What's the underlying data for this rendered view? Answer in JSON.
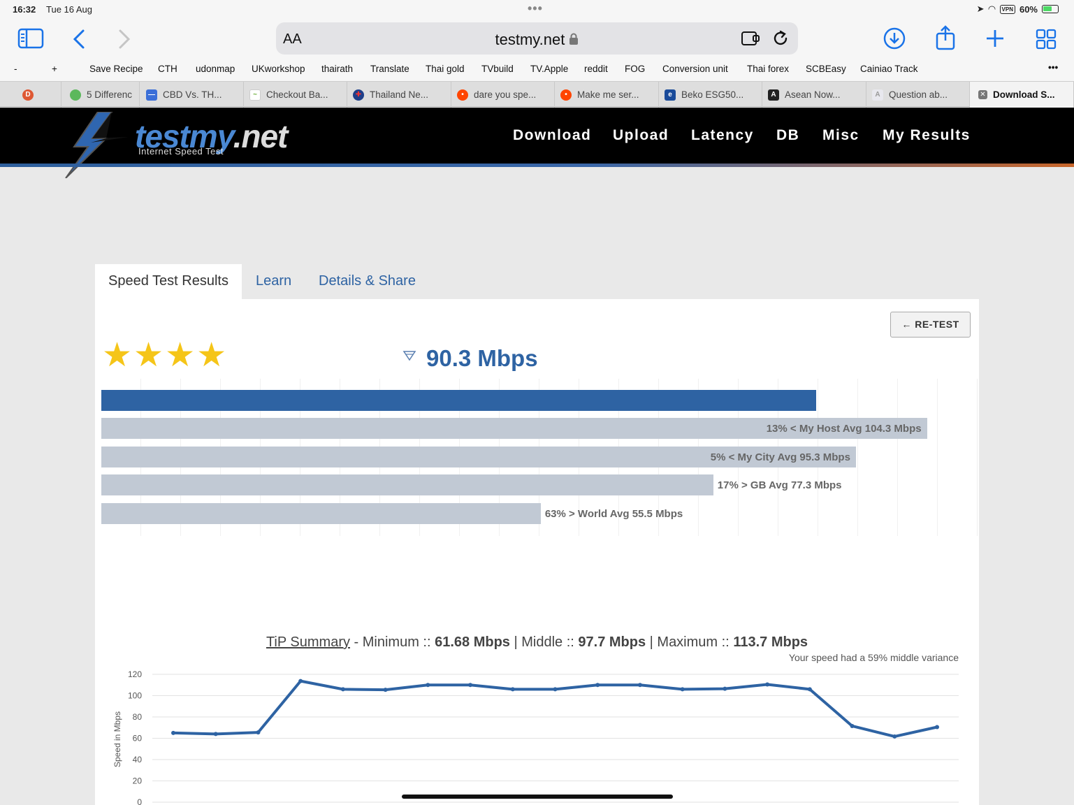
{
  "status_bar": {
    "time": "16:32",
    "date": "Tue 16 Aug",
    "vpn": "VPN",
    "battery": "60%"
  },
  "safari": {
    "font_button": "AA",
    "url": "testmy.net",
    "icons": [
      "sidebar-icon",
      "back-icon",
      "forward-icon",
      "lock-icon",
      "extension-icon",
      "reload-icon",
      "download-icon",
      "share-icon",
      "new-tab-icon",
      "tab-overview-icon"
    ]
  },
  "bookmarks": [
    "-",
    "+",
    "Save Recipe",
    "CTH",
    "udonmap",
    "UKworkshop",
    "thairath",
    "Translate",
    "Thai gold",
    "TVbuild",
    "TV.Apple",
    "reddit",
    "FOG",
    "Conversion unit",
    "Thai forex",
    "SCBEasy",
    "Cainiao Track",
    "•••"
  ],
  "tabs": [
    {
      "label": "5 Differenc"
    },
    {
      "label": "CBD Vs. TH..."
    },
    {
      "label": "Checkout Ba..."
    },
    {
      "label": "Thailand Ne..."
    },
    {
      "label": "dare you spe..."
    },
    {
      "label": "Make me ser..."
    },
    {
      "label": "Beko ESG50..."
    },
    {
      "label": "Asean Now..."
    },
    {
      "label": "Question ab..."
    },
    {
      "label": "Download S..."
    }
  ],
  "site": {
    "logo": "testmy",
    "logo_tld": ".net",
    "logo_sub": "Internet Speed Test",
    "nav": [
      "Download",
      "Upload",
      "Latency",
      "DB",
      "Misc",
      "My Results"
    ]
  },
  "results": {
    "tabs": [
      "Speed Test Results",
      "Learn",
      "Details & Share"
    ],
    "retest": "← RE-TEST",
    "stars": "★★★★",
    "rating": 4,
    "speed": "90.3 Mbps",
    "comparisons": [
      {
        "label": "13% < My Host Avg 104.3 Mbps",
        "value": 104.3
      },
      {
        "label": "5% < My City Avg 95.3 Mbps",
        "value": 95.3
      },
      {
        "label": "17% > GB Avg 77.3 Mbps",
        "value": 77.3
      },
      {
        "label": "63% > World Avg 55.5 Mbps",
        "value": 55.5
      }
    ],
    "my_speed_value": 90.3
  },
  "tip": {
    "link": "TiP Summary",
    "sep1": " - Minimum :: ",
    "min": "61.68 Mbps",
    "sep2": " | Middle :: ",
    "mid": "97.7 Mbps",
    "sep3": " | Maximum :: ",
    "max": "113.7 Mbps",
    "variance": "Your speed had a 59% middle variance"
  },
  "chart_data": {
    "type": "line",
    "title": "",
    "xlabel": "",
    "ylabel": "Speed in Mbps",
    "ylim": [
      0,
      120
    ],
    "yticks": [
      0,
      20,
      40,
      60,
      80,
      100,
      120
    ],
    "grid": true,
    "series": [
      {
        "values": [
          65,
          64,
          65.5,
          113.7,
          106,
          105.5,
          110,
          110,
          106,
          106,
          110,
          110,
          106,
          106.5,
          110.5,
          106,
          71.5,
          61.68,
          70.5
        ]
      }
    ],
    "color": "#2e63a3"
  }
}
